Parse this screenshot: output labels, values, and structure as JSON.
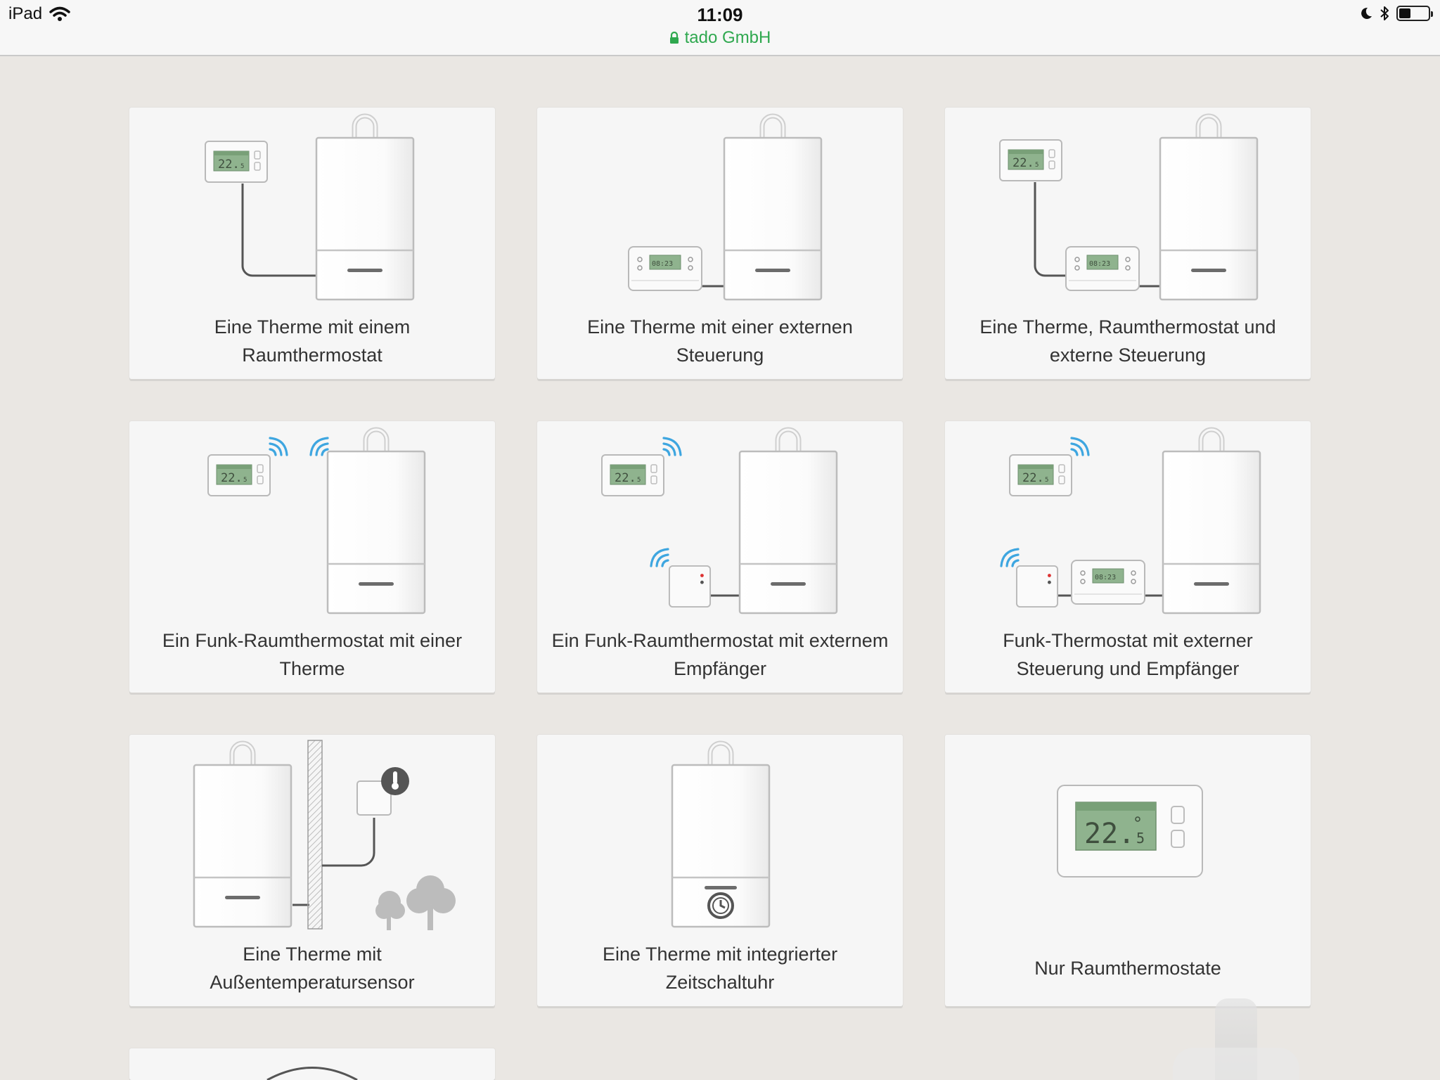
{
  "status_bar": {
    "device": "iPad",
    "time": "11:09",
    "site": "tado GmbH",
    "battery_level": 0.4
  },
  "cards": [
    {
      "id": "boiler-room-thermostat",
      "caption": "Eine Therme mit einem Raumthermostat"
    },
    {
      "id": "boiler-external-control",
      "caption": "Eine Therme mit einer externen Steuerung"
    },
    {
      "id": "boiler-thermostat-external",
      "caption": "Eine Therme, Raumthermostat und externe Steuerung"
    },
    {
      "id": "wireless-thermostat-boiler",
      "caption": "Ein Funk-Raumthermostat mit einer Therme"
    },
    {
      "id": "wireless-thermostat-receiver",
      "caption": "Ein Funk-Raumthermostat mit externem Empfänger"
    },
    {
      "id": "wireless-external-receiver",
      "caption": "Funk-Thermostat mit externer Steuerung und Empfänger"
    },
    {
      "id": "boiler-outdoor-sensor",
      "caption": "Eine Therme mit Außentemperatursensor"
    },
    {
      "id": "boiler-integrated-timer",
      "caption": "Eine Therme mit integrierter Zeitschaltuhr"
    },
    {
      "id": "room-thermostats-only",
      "caption": "Nur Raumthermostate"
    },
    {
      "id": "partial-card",
      "caption": ""
    }
  ],
  "thermostat_display": "22.5",
  "timer_display": "08:23",
  "colors": {
    "wifi": "#3ea6e0",
    "lcd": "#8fb38e",
    "url": "#2fa84f"
  }
}
